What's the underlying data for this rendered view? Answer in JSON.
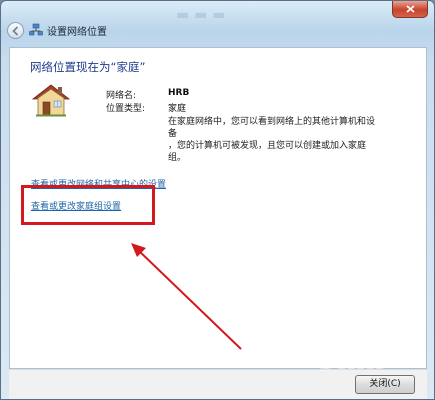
{
  "window": {
    "title": "设置网络位置"
  },
  "main": {
    "heading": "网络位置现在为“家庭”",
    "network_name_label": "网络名:",
    "network_name_value": "HRB",
    "location_type_label": "位置类型:",
    "location_type_value": "家庭",
    "description_line1": "在家庭网络中，您可以看到网络上的其他计算机和设备",
    "description_line2": "，您的计算机可被发现，且您可以创建或加入家庭组。",
    "link_network_sharing": "查看或更改网络和共享中心的设置",
    "link_homegroup": "查看或更改家庭组设置"
  },
  "footer": {
    "close_button_label": "关闭(C)"
  },
  "colors": {
    "highlight": "#d4181d",
    "link": "#1f66a8",
    "heading": "#1e3c8c"
  },
  "icons": [
    "back-arrow-icon",
    "network-icon",
    "close-icon",
    "house-icon"
  ]
}
